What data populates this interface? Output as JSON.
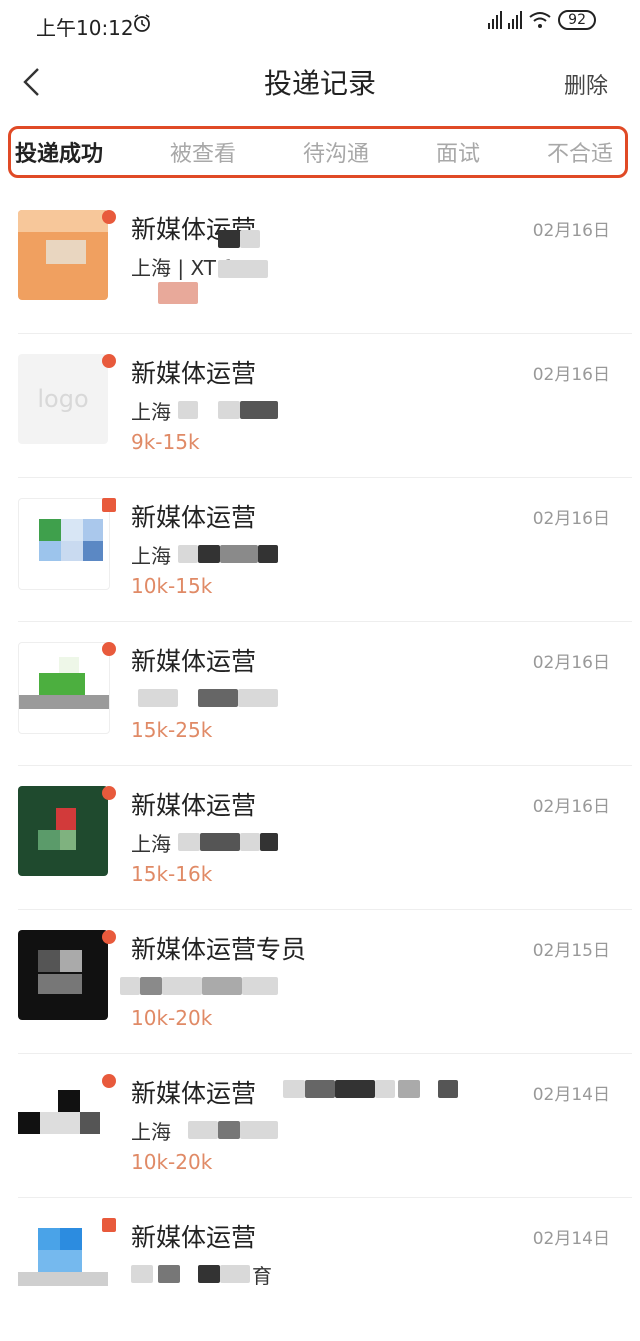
{
  "status_bar": {
    "time": "上午10:12",
    "battery": "92"
  },
  "header": {
    "title": "投递记录",
    "delete_label": "删除"
  },
  "tabs": [
    {
      "label": "投递成功",
      "active": true
    },
    {
      "label": "被查看",
      "active": false
    },
    {
      "label": "待沟通",
      "active": false
    },
    {
      "label": "面试",
      "active": false
    },
    {
      "label": "不合适",
      "active": false
    }
  ],
  "colors": {
    "accent": "#e04a26",
    "salary": "#e08a66",
    "dot": "#e85a3c"
  },
  "records": [
    {
      "title": "新媒体运营",
      "date": "02月16日",
      "location": "上海 | XT  fer",
      "salary": "",
      "logo": "orange"
    },
    {
      "title": "新媒体运营",
      "date": "02月16日",
      "location": "上海",
      "salary": "9k-15k",
      "logo": "placeholder",
      "logo_text": "logo"
    },
    {
      "title": "新媒体运营",
      "date": "02月16日",
      "location": "上海",
      "salary": "10k-15k",
      "logo": "blue-green"
    },
    {
      "title": "新媒体运营",
      "date": "02月16日",
      "location": "",
      "salary": "15k-25k",
      "logo": "green"
    },
    {
      "title": "新媒体运营",
      "date": "02月16日",
      "location": "上海",
      "salary": "15k-16k",
      "logo": "dark-green"
    },
    {
      "title": "新媒体运营专员",
      "date": "02月15日",
      "location": "",
      "salary": "10k-20k",
      "logo": "black"
    },
    {
      "title": "新媒体运营",
      "date": "02月14日",
      "location": "上海",
      "salary": "10k-20k",
      "logo": "checker"
    },
    {
      "title": "新媒体运营",
      "date": "02月14日",
      "location": "育",
      "salary": "",
      "logo": "blue"
    }
  ]
}
